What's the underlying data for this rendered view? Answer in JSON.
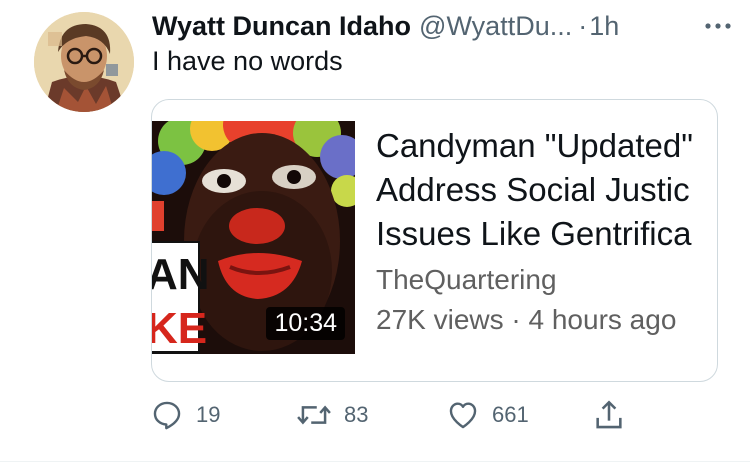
{
  "tweet": {
    "author_name": "Wyatt Duncan Idaho",
    "author_handle": "@WyattDu...",
    "separator": "·",
    "time": "1h",
    "text": "I have no words"
  },
  "card": {
    "title_lines": [
      "Candyman \"Updated\"",
      "Address Social Justic",
      "Issues Like Gentrifica"
    ],
    "channel": "TheQuartering",
    "meta": "27K views · 4 hours ago",
    "duration": "10:34",
    "thumbnail_text": [
      "AN",
      "KE"
    ]
  },
  "actions": {
    "reply_count": "19",
    "retweet_count": "83",
    "like_count": "661"
  },
  "icons": {
    "more": "more-icon",
    "reply": "reply-icon",
    "retweet": "retweet-icon",
    "like": "heart-icon",
    "share": "share-icon"
  },
  "colors": {
    "text": "#0f1419",
    "secondary": "#536471",
    "border": "#cfd9de"
  }
}
